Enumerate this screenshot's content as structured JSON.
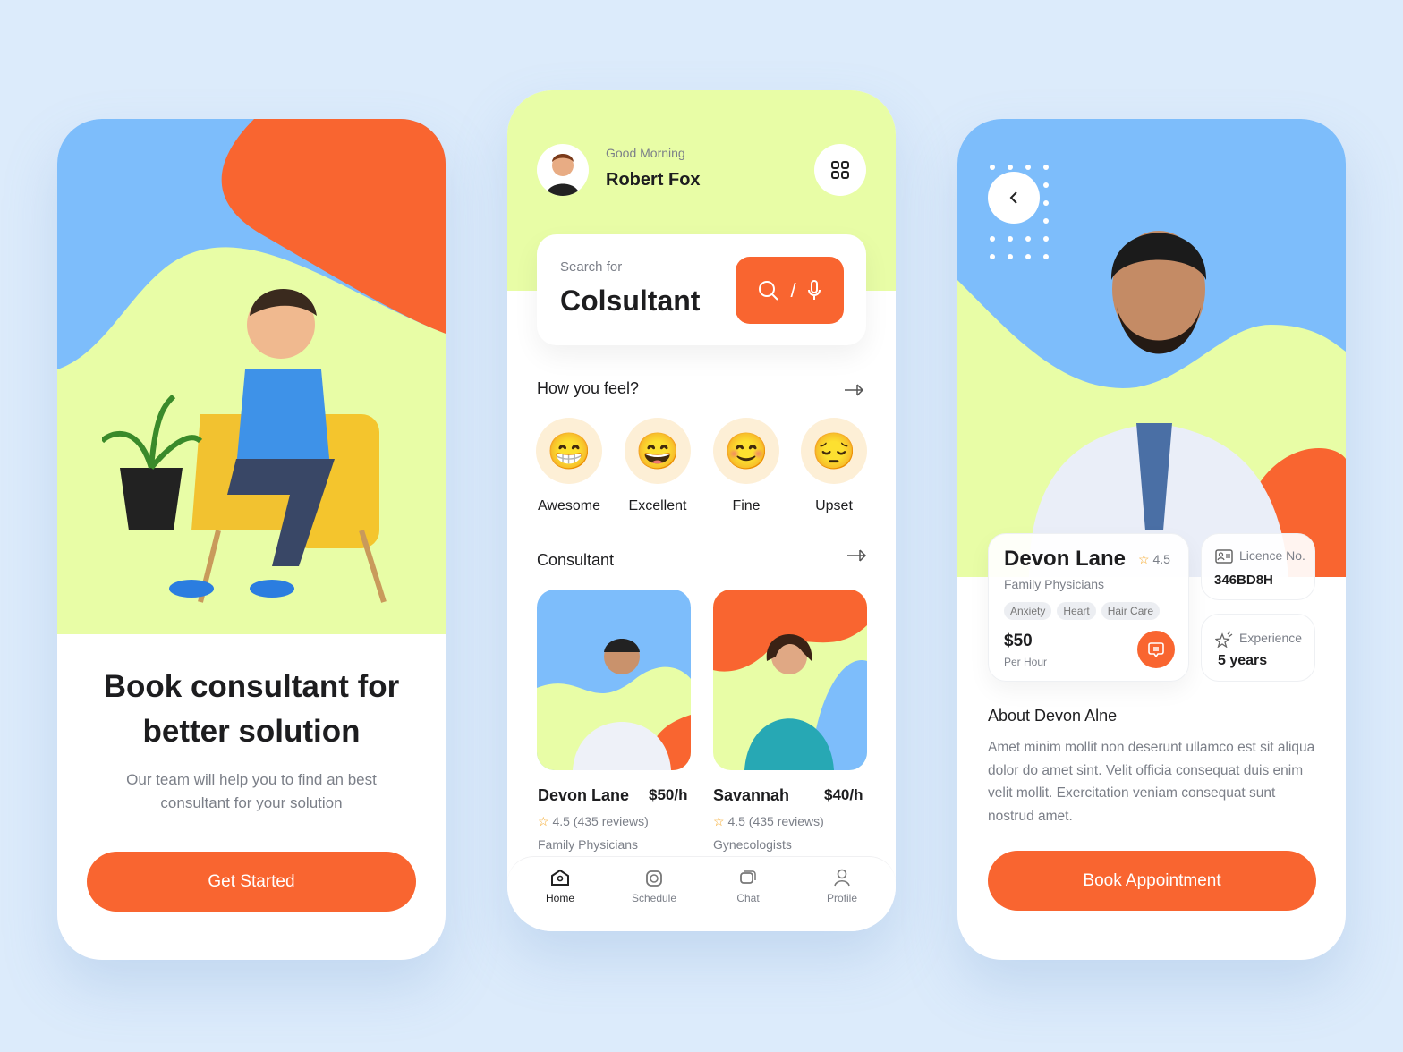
{
  "onboarding": {
    "title_line1": "Book consultant for",
    "title_line2": "better solution",
    "subtitle_line1": "Our team will help you to find an best",
    "subtitle_line2": "consultant for your solution",
    "cta": "Get Started"
  },
  "home": {
    "greeting": "Good Morning",
    "user_name": "Robert Fox",
    "search": {
      "label": "Search for",
      "value": "Colsultant",
      "divider": "/"
    },
    "feel_title": "How you feel?",
    "moods": [
      {
        "label": "Awesome",
        "emoji": "😁"
      },
      {
        "label": "Excellent",
        "emoji": "😄"
      },
      {
        "label": "Fine",
        "emoji": "😊"
      },
      {
        "label": "Upset",
        "emoji": "😔"
      }
    ],
    "consultant_title": "Consultant",
    "consultants": [
      {
        "name": "Devon Lane",
        "price": "$50/h",
        "rating": "4.5 (435 reviews)",
        "specialty": "Family Physicians"
      },
      {
        "name": "Savannah",
        "price": "$40/h",
        "rating": "4.5 (435 reviews)",
        "specialty": "Gynecologists"
      }
    ],
    "nav": [
      {
        "label": "Home",
        "active": true
      },
      {
        "label": "Schedule"
      },
      {
        "label": "Chat"
      },
      {
        "label": "Profile"
      }
    ]
  },
  "detail": {
    "name": "Devon Lane",
    "rating": "4.5",
    "specialty": "Family Physicians",
    "tags": [
      "Anxiety",
      "Heart",
      "Hair Care"
    ],
    "price": "$50",
    "price_unit": "Per Hour",
    "licence_label": "Licence No.",
    "licence_value": "346BD8H",
    "experience_label": "Experience",
    "experience_value": "5 years",
    "about_title": "About Devon Alne",
    "about_text": "Amet minim mollit non deserunt ullamco est sit aliqua dolor do amet sint. Velit officia consequat duis enim velit mollit. Exercitation veniam consequat sunt nostrud amet.",
    "cta": "Book Appointment"
  },
  "colors": {
    "accent": "#f96530",
    "lime": "#e8fda6",
    "blue": "#7dbdfb",
    "background": "#dcebfb"
  }
}
